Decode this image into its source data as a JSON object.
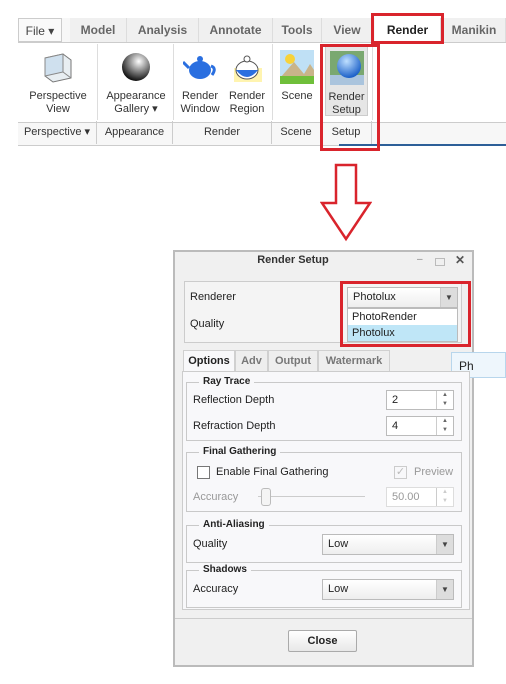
{
  "ribbon": {
    "tabs": [
      {
        "label": "File ▾"
      },
      {
        "label": "Model"
      },
      {
        "label": "Analysis"
      },
      {
        "label": "Annotate"
      },
      {
        "label": "Tools"
      },
      {
        "label": "View"
      },
      {
        "label": "Render"
      },
      {
        "label": "Manikin"
      }
    ],
    "active_tab": "Render",
    "buttons": [
      {
        "line1": "Perspective",
        "line2": "View",
        "icon": "perspective-view-icon"
      },
      {
        "line1": "Appearance",
        "line2": "Gallery ▾",
        "icon": "appearance-sphere-icon"
      },
      {
        "line1": "Render",
        "line2": "Window",
        "icon": "teapot-icon"
      },
      {
        "line1": "Render",
        "line2": "Region",
        "icon": "teapot-region-icon"
      },
      {
        "line1": "Scene",
        "line2": "",
        "icon": "scene-landscape-icon"
      },
      {
        "line1": "Render",
        "line2": "Setup",
        "icon": "render-setup-icon"
      }
    ],
    "groups": [
      {
        "label": "Perspective ▾"
      },
      {
        "label": "Appearance"
      },
      {
        "label": "Render"
      },
      {
        "label": "Scene"
      },
      {
        "label": "Setup"
      }
    ]
  },
  "highlight_color": "#d9242c",
  "dialog": {
    "title": "Render Setup",
    "renderer_label": "Renderer",
    "renderer_value": "Photolux",
    "renderer_options": [
      "PhotoRender",
      "Photolux"
    ],
    "quality_label": "Quality",
    "tooltip": "Ph",
    "tabs": [
      "Options",
      "Adv",
      "Output",
      "Watermark"
    ],
    "ray_trace": {
      "title": "Ray Trace",
      "reflection_label": "Reflection Depth",
      "reflection_value": "2",
      "refraction_label": "Refraction Depth",
      "refraction_value": "4"
    },
    "final_gathering": {
      "title": "Final Gathering",
      "enable_label": "Enable Final Gathering",
      "enabled": false,
      "preview_label": "Preview",
      "preview_checked": true,
      "accuracy_label": "Accuracy",
      "accuracy_value": "50.00"
    },
    "anti_aliasing": {
      "title": "Anti-Aliasing",
      "quality_label": "Quality",
      "quality_value": "Low"
    },
    "shadows": {
      "title": "Shadows",
      "accuracy_label": "Accuracy",
      "accuracy_value": "Low"
    },
    "close_label": "Close"
  }
}
